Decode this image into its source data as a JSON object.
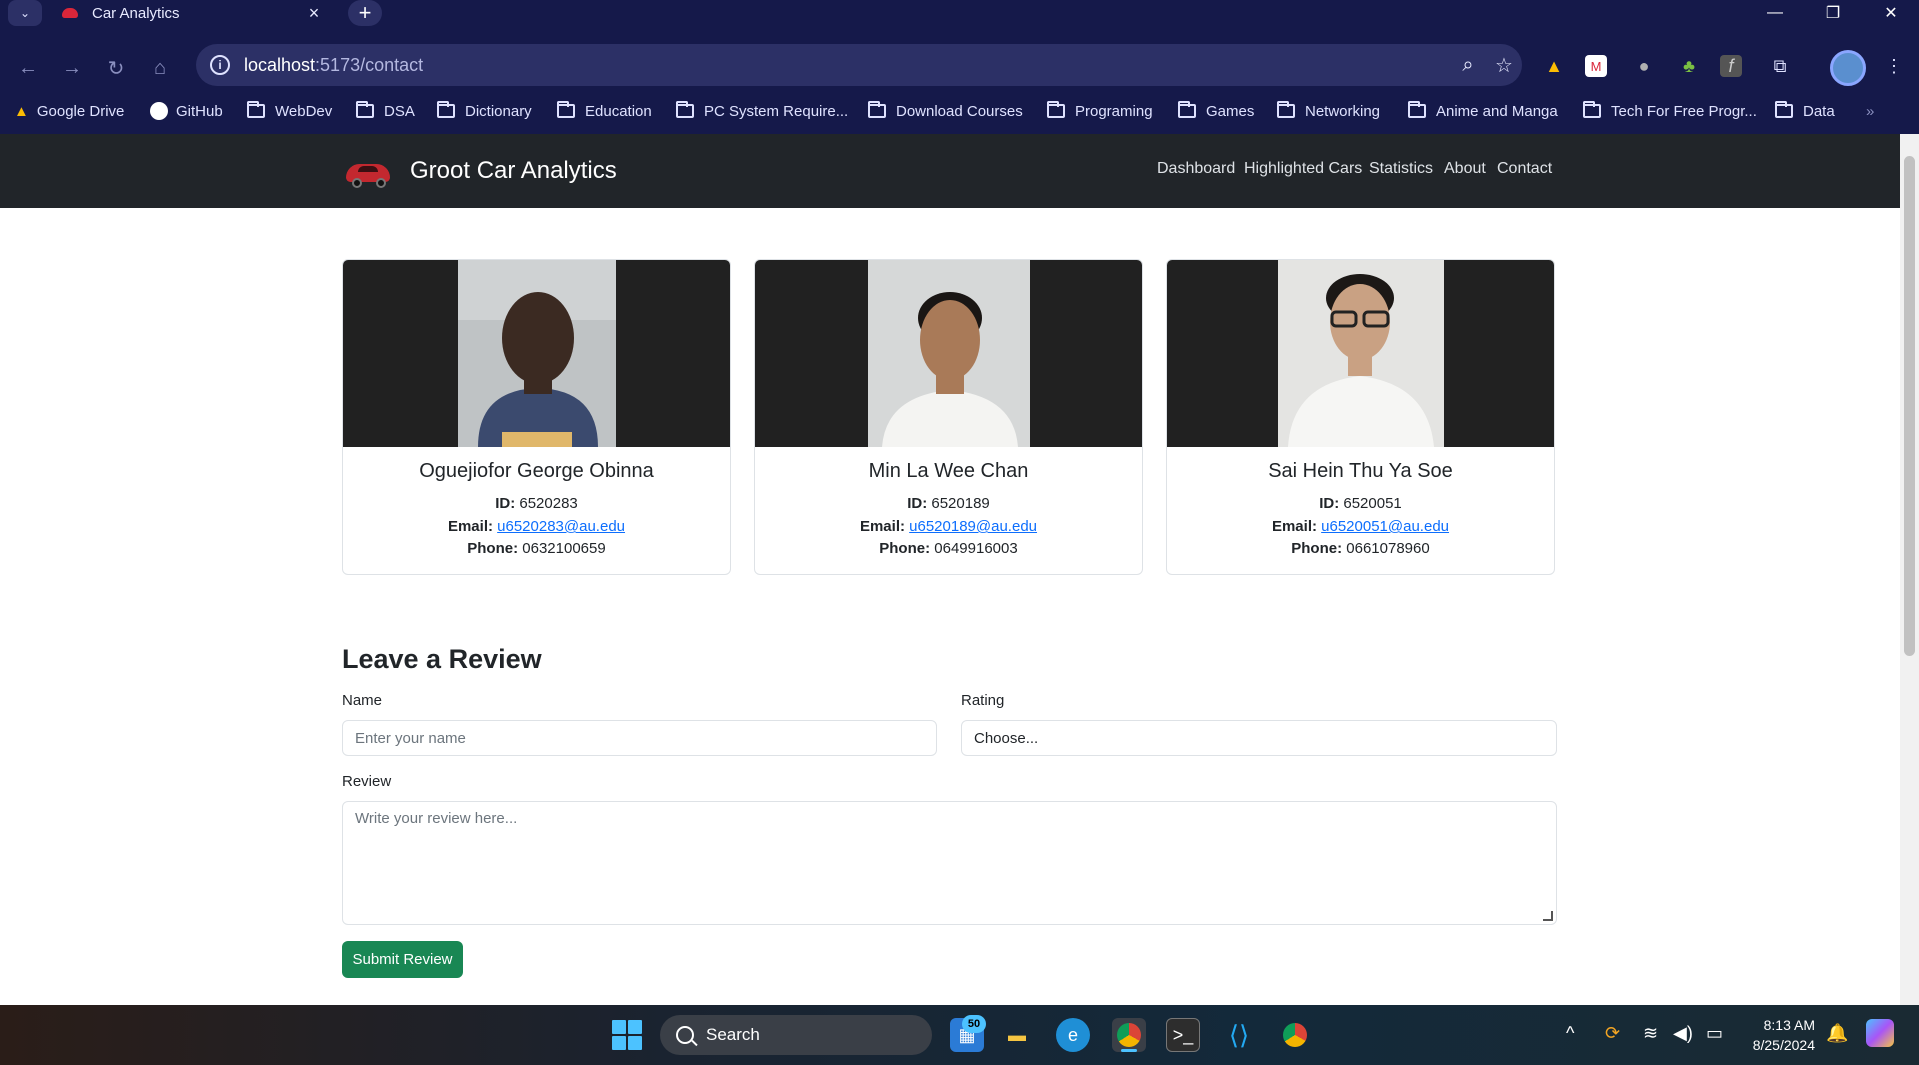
{
  "browser": {
    "tab_title": "Car Analytics",
    "url_host": "localhost",
    "url_rest": ":5173/contact",
    "bookmarks": [
      "Google Drive",
      "GitHub",
      "WebDev",
      "DSA",
      "Dictionary",
      "Education",
      "PC System Require...",
      "Download Courses",
      "Programing",
      "Games",
      "Networking",
      "Anime and Manga",
      "Tech For Free Progr...",
      "Data"
    ]
  },
  "navbar": {
    "brand": "Groot Car Analytics",
    "links": [
      "Dashboard",
      "Highlighted Cars",
      "Statistics",
      "About",
      "Contact"
    ]
  },
  "team": [
    {
      "name": "Oguejiofor George Obinna",
      "id_label": "ID:",
      "id": "6520283",
      "email_label": "Email:",
      "email": "u6520283@au.edu",
      "phone_label": "Phone:",
      "phone": "0632100659"
    },
    {
      "name": "Min La Wee Chan",
      "id_label": "ID:",
      "id": "6520189",
      "email_label": "Email:",
      "email": "u6520189@au.edu",
      "phone_label": "Phone:",
      "phone": "0649916003"
    },
    {
      "name": "Sai Hein Thu Ya Soe",
      "id_label": "ID:",
      "id": "6520051",
      "email_label": "Email:",
      "email": "u6520051@au.edu",
      "phone_label": "Phone:",
      "phone": "0661078960"
    }
  ],
  "review": {
    "heading": "Leave a Review",
    "name_label": "Name",
    "name_placeholder": "Enter your name",
    "rating_label": "Rating",
    "rating_value": "Choose...",
    "review_label": "Review",
    "review_placeholder": "Write your review here...",
    "submit": "Submit Review"
  },
  "taskbar": {
    "search": "Search",
    "badge": "50",
    "time": "8:13 AM",
    "date": "8/25/2024"
  },
  "colors": {
    "navbar_bg": "#212529",
    "accent_green": "#198754",
    "link_blue": "#0d6efd",
    "chrome_bg": "#15194a"
  }
}
